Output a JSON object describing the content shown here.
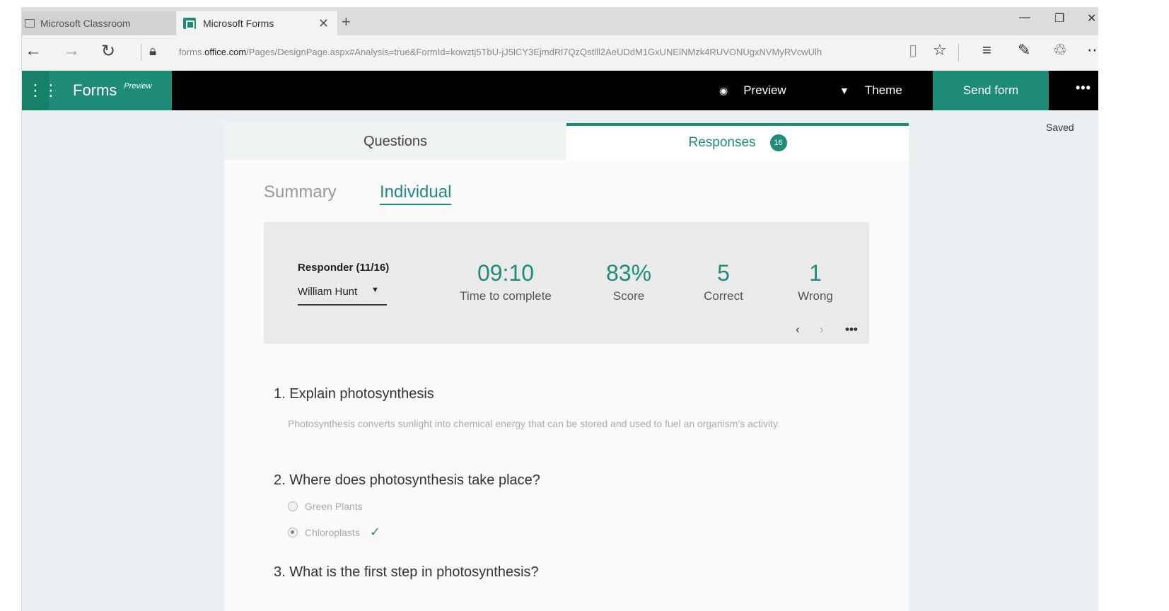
{
  "browser": {
    "tabs": [
      {
        "label": "Microsoft Classroom",
        "active": false
      },
      {
        "label": "Microsoft Forms",
        "active": true
      }
    ],
    "url_prefix": "forms.",
    "url_domain": "office.com",
    "url_path": "/Pages/DesignPage.aspx#Analysis=true&FormId=kowztj5TbU-jJ5lCY3EjmdRl7QzQstlll2AeUDdM1GxUNElNMzk4RUVONUgxNVMyRVcwUlh"
  },
  "appbar": {
    "brand": "Forms",
    "brand_tag": "Preview",
    "preview_label": "Preview",
    "theme_label": "Theme",
    "send_label": "Send form"
  },
  "status": {
    "saved": "Saved"
  },
  "tabs": {
    "questions": "Questions",
    "responses": "Responses",
    "responses_count": "16"
  },
  "subtabs": {
    "summary": "Summary",
    "individual": "Individual"
  },
  "responder": {
    "label": "Responder (11/16)",
    "selected": "William Hunt"
  },
  "stats": {
    "time_value": "09:10",
    "time_label": "Time to complete",
    "score_value": "83%",
    "score_label": "Score",
    "correct_value": "5",
    "correct_label": "Correct",
    "wrong_value": "1",
    "wrong_label": "Wrong"
  },
  "questions": [
    {
      "title": "1. Explain photosynthesis",
      "answer": "Photosynthesis converts sunlight into chemical energy that can be stored and used to fuel an organism's activity."
    },
    {
      "title": "2. Where does photosynthesis take place?",
      "options": [
        "Green Plants",
        "Chloroplasts"
      ],
      "selected": "Chloroplasts"
    },
    {
      "title": "3. What is the first step in photosynthesis?"
    }
  ],
  "colors": {
    "accent": "#1e8c77",
    "check": "#2a9d3e"
  }
}
